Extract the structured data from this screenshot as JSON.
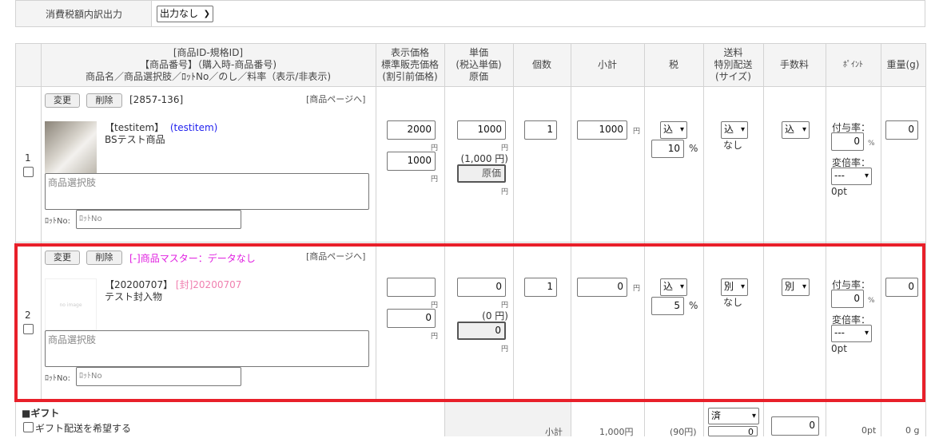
{
  "tax_output": {
    "label": "消費税額内訳出力",
    "value": "出力なし"
  },
  "headers": {
    "product": [
      "[商品ID-規格ID]",
      "【商品番号】（購入時-商品番号)",
      "商品名／商品選択肢／ﾛｯﾄNo／のし／料率（表示/非表示)"
    ],
    "price": [
      "表示価格",
      "標準販売価格",
      "(割引前価格)"
    ],
    "unit": [
      "単価",
      "(税込単価)",
      "原価"
    ],
    "qty": "個数",
    "subtotal": "小計",
    "tax": "税",
    "shipping": [
      "送料",
      "特別配送",
      "(サイズ)"
    ],
    "fee": "手数料",
    "point": "ﾎﾟｲﾝﾄ",
    "weight": "重量(g)"
  },
  "labels": {
    "change": "変更",
    "delete": "削除",
    "product_page": "[商品ページへ]",
    "option_placeholder": "商品選択肢",
    "lot_label": "ﾛｯﾄNo:",
    "lot_placeholder": "ﾛｯﾄNo",
    "yen": "円",
    "percent": "%",
    "grant_rate": "付与率：",
    "multiplier": "変倍率：",
    "none": "なし",
    "cost_placeholder": "原価"
  },
  "items": [
    {
      "index": "1",
      "id": "[2857-136]",
      "warning": "",
      "code": "【testitem】",
      "code2": "(testitem)",
      "name": "BSテスト商品",
      "display_price": "2000",
      "list_price": "1000",
      "unit_price": "1000",
      "unit_incl": "(1,000 円)",
      "cost": "",
      "qty": "1",
      "subtotal": "1000",
      "tax_mode": "込",
      "tax_rate": "10",
      "ship_mode": "込",
      "fee_mode": "込",
      "grant_rate": "0",
      "multiplier": "---",
      "points": "0pt",
      "weight": "0",
      "image": "photo"
    },
    {
      "index": "2",
      "id": "",
      "warning": "[-]商品マスター：データなし",
      "code": "【20200707】",
      "code2": "[封]20200707",
      "name": "テスト封入物",
      "display_price": "",
      "list_price": "0",
      "unit_price": "0",
      "unit_incl": "(0 円)",
      "cost": "0",
      "qty": "1",
      "subtotal": "0",
      "tax_mode": "込",
      "tax_rate": "5",
      "ship_mode": "別",
      "fee_mode": "別",
      "grant_rate": "0",
      "multiplier": "---",
      "points": "0pt",
      "weight": "0",
      "image": "no image"
    }
  ],
  "footer": {
    "gift_title": "■ギフト",
    "gift_check": "ギフト配送を希望する",
    "subtotal_label": "小計",
    "subtotal": "1,000円",
    "tax": "(90円)",
    "ship_status": "済",
    "ship_value": "0",
    "fee_value": "0",
    "points": "0pt",
    "weight": "0 g"
  },
  "colors": {
    "highlight": "#e8202a",
    "link_blue": "#2222ee",
    "warning_magenta": "#e020e0",
    "enclosure_pink": "#f080b0"
  }
}
